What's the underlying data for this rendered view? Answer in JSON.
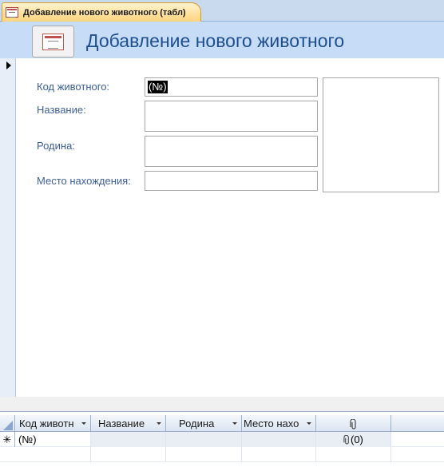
{
  "tab": {
    "title": "Добавление нового животного (табл)"
  },
  "header": {
    "title": "Добавление нового животного",
    "icon": "form-icon"
  },
  "form": {
    "fields": [
      {
        "label": "Код животного:",
        "value": "(№)"
      },
      {
        "label": "Название:",
        "value": ""
      },
      {
        "label": "Родина:",
        "value": ""
      },
      {
        "label": "Место нахождения:",
        "value": ""
      }
    ],
    "photo": ""
  },
  "datasheet": {
    "columns": [
      "Код животн",
      "Название",
      "Родина",
      "Место нахо"
    ],
    "attachment_icon": "paperclip-icon",
    "new_row": {
      "selector": "✳",
      "id": "(№)",
      "attachments": "(0)"
    }
  }
}
